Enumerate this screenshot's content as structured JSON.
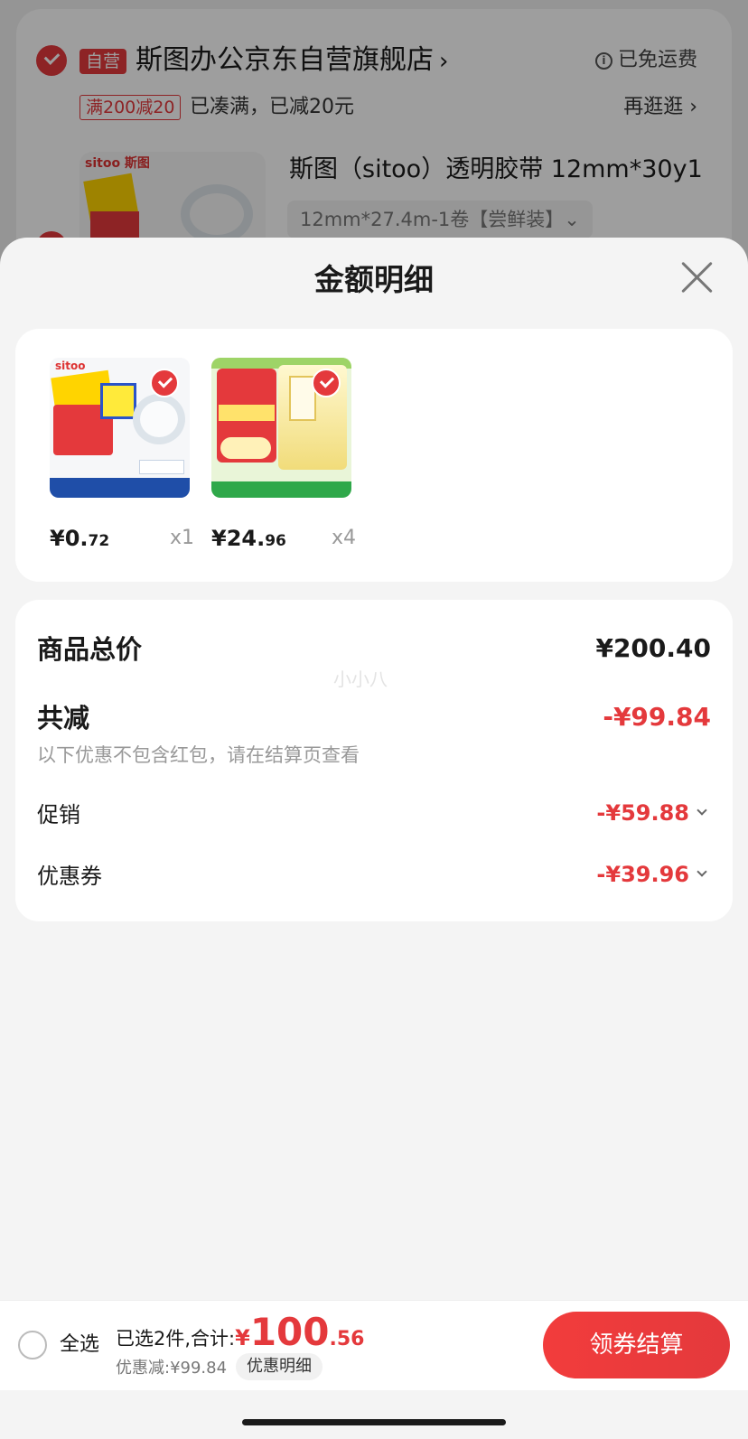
{
  "background_cart": {
    "self_operated_tag": "自营",
    "store_name": "斯图办公京东自营旗舰店",
    "store_arrow": "›",
    "shipping_note": "已免运费",
    "promo_tag": "满200减20",
    "promo_text": "已凑满，已减20元",
    "browse_more": "再逛逛 ›",
    "thumb_brand": "sitoo 斯图",
    "product_title": "斯图（sitoo）透明胶带 12mm*30y1",
    "product_spec": "12mm*27.4m-1卷【尝鲜装】⌄"
  },
  "sheet": {
    "title": "金额明细",
    "close_icon": "close-icon"
  },
  "goods": [
    {
      "price_main": "¥0.",
      "price_cents": "72",
      "qty": "x1",
      "image": "tape-product-image"
    },
    {
      "price_main": "¥24.",
      "price_cents": "96",
      "qty": "x4",
      "image": "rice-product-image"
    }
  ],
  "summary": {
    "total_label": "商品总价",
    "total_value": "¥200.40",
    "reduce_label": "共减",
    "reduce_value": "-¥99.84",
    "note": "以下优惠不包含红包，请在结算页查看",
    "promotion_label": "促销",
    "promotion_value": "-¥59.88",
    "coupon_label": "优惠券",
    "coupon_value": "-¥39.96",
    "watermark": "小小八"
  },
  "bottom_bar": {
    "select_all": "全选",
    "selected_prefix": "已选2件,合计:",
    "currency": "¥",
    "total_int": "100",
    "total_dec": ".56",
    "discount_text": "优惠减:¥99.84",
    "detail_button": "优惠明细",
    "checkout_button": "领券结算"
  },
  "colors": {
    "accent": "#e4393c",
    "background": "#f4f4f4"
  }
}
